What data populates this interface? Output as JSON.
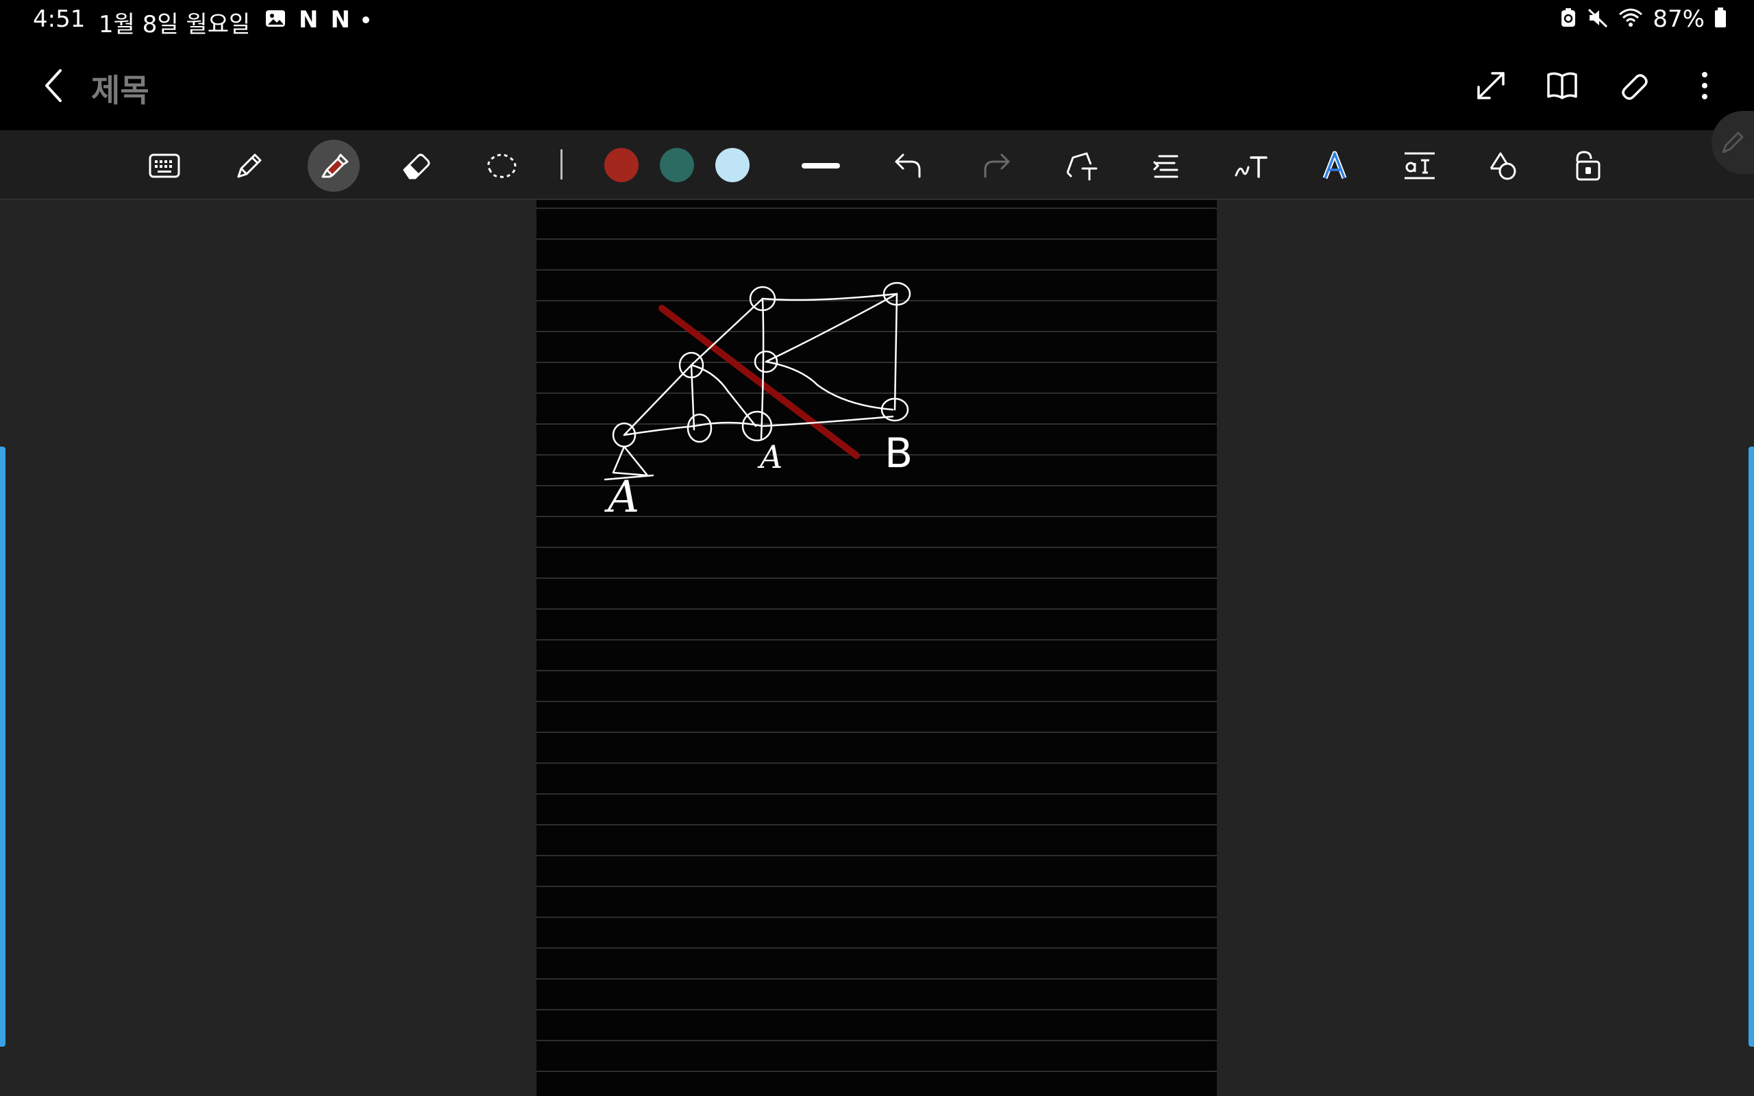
{
  "status_bar": {
    "time": "4:51",
    "date": "1월 8일 월요일",
    "notification_icons": [
      "gallery-icon",
      "netflix-icon",
      "netflix-icon",
      "dot-icon"
    ],
    "app_letters": [
      "N",
      "N"
    ],
    "system_icons": [
      "battery-saver-icon",
      "mute-icon",
      "wifi-icon",
      "battery-icon"
    ],
    "battery": "87%"
  },
  "app_bar": {
    "title": "제목",
    "actions": [
      "expand-icon",
      "book-view-icon",
      "attach-icon",
      "more-icon"
    ]
  },
  "toolbar": {
    "tools": [
      "keyboard",
      "pen",
      "highlighter",
      "eraser",
      "lasso"
    ],
    "active_tool": "highlighter",
    "colors": [
      "#a3271c",
      "#2b6b62",
      "#bfe4f5"
    ],
    "stroke": "thick",
    "actions": [
      "undo",
      "redo",
      "shape-to-text",
      "align",
      "handwriting-to-text",
      "text-style",
      "text-size",
      "shapes",
      "lock"
    ]
  },
  "note": {
    "ruled": true,
    "handwritten_labels": [
      "A",
      "A",
      "B"
    ]
  },
  "colors": {
    "accent": "#3aa3e6",
    "highlighter": "#8b0b0b",
    "ink": "#ffffff"
  }
}
